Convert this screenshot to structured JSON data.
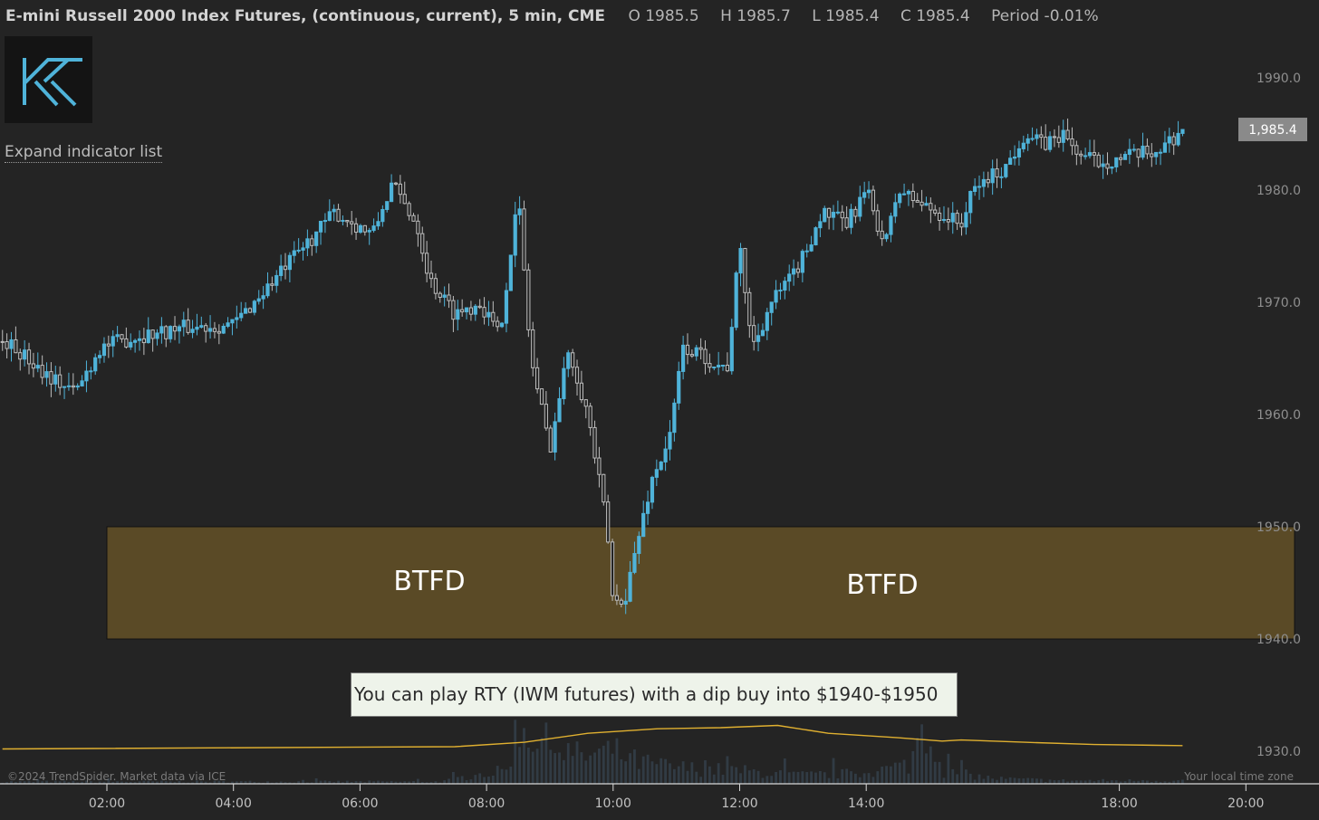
{
  "header": {
    "title": "E-mini Russell 2000 Index Futures, (continuous, current), 5 min, CME",
    "open": "O 1985.5",
    "high": "H 1985.7",
    "low": "L 1985.4",
    "close": "C 1985.4",
    "period": "Period -0.01%"
  },
  "expand_label": "Expand indicator list",
  "note": "You can play RTY (IWM futures) with a dip buy into $1940-$1950",
  "copyright": "©2024 TrendSpider. Market data via ICE",
  "timezone_label": "Your local time zone",
  "colors": {
    "up": "#4fb3d9",
    "down": "#bdbdbd",
    "zone": "#5a4a26",
    "avg": "#e0b030",
    "bg": "#242424"
  },
  "chart_data": {
    "type": "candlestick",
    "interval": "5 min",
    "ylim": [
      1927,
      1993
    ],
    "xlim": [
      0.35,
      21.15
    ],
    "yticks": [
      "1990.0",
      "1980.0",
      "1970.0",
      "1960.0",
      "1950.0",
      "1940.0",
      "1930.0"
    ],
    "xticks": [
      {
        "label": "02:00",
        "hour": 2
      },
      {
        "label": "04:00",
        "hour": 4
      },
      {
        "label": "06:00",
        "hour": 6
      },
      {
        "label": "08:00",
        "hour": 8
      },
      {
        "label": "10:00",
        "hour": 10
      },
      {
        "label": "12:00",
        "hour": 12
      },
      {
        "label": "14:00",
        "hour": 14
      },
      {
        "label": "18:00",
        "hour": 18
      },
      {
        "label": "20:00",
        "hour": 20
      }
    ],
    "last_price": "1,985.4",
    "last_value": 1985.4,
    "zone": {
      "low": 1940,
      "high": 1950,
      "labels": [
        "BTFD",
        "BTFD"
      ]
    },
    "path": [
      [
        0.4,
        1966.5
      ],
      [
        1.2,
        1963
      ],
      [
        1.5,
        1962
      ],
      [
        1.9,
        1966
      ],
      [
        2.5,
        1967
      ],
      [
        3.3,
        1967.8
      ],
      [
        4.0,
        1968
      ],
      [
        4.8,
        1973
      ],
      [
        5.6,
        1978
      ],
      [
        6.2,
        1976
      ],
      [
        6.5,
        1980.5
      ],
      [
        6.9,
        1977
      ],
      [
        7.1,
        1972
      ],
      [
        7.5,
        1969
      ],
      [
        7.9,
        1970
      ],
      [
        8.2,
        1967
      ],
      [
        8.5,
        1979.5
      ],
      [
        8.7,
        1965
      ],
      [
        9.0,
        1957
      ],
      [
        9.3,
        1966
      ],
      [
        9.6,
        1960
      ],
      [
        9.9,
        1950
      ],
      [
        10.0,
        1943
      ],
      [
        10.2,
        1944
      ],
      [
        10.4,
        1949
      ],
      [
        10.6,
        1954
      ],
      [
        10.9,
        1958
      ],
      [
        11.1,
        1966
      ],
      [
        11.5,
        1965
      ],
      [
        11.8,
        1964
      ],
      [
        12.0,
        1975
      ],
      [
        12.2,
        1966
      ],
      [
        12.5,
        1970
      ],
      [
        12.8,
        1972
      ],
      [
        13.0,
        1974
      ],
      [
        13.3,
        1978
      ],
      [
        13.7,
        1977
      ],
      [
        14.0,
        1980
      ],
      [
        14.3,
        1975
      ],
      [
        14.5,
        1980
      ],
      [
        14.8,
        1979
      ],
      [
        15.1,
        1978
      ],
      [
        15.5,
        1977
      ],
      [
        15.7,
        1980
      ],
      [
        15.9,
        1981
      ],
      [
        16.2,
        1982
      ],
      [
        16.5,
        1985
      ],
      [
        16.8,
        1984
      ],
      [
        17.1,
        1985
      ],
      [
        17.4,
        1983
      ],
      [
        17.7,
        1982.5
      ],
      [
        18.2,
        1983
      ],
      [
        18.6,
        1983.5
      ],
      [
        19.0,
        1985.4
      ]
    ],
    "avg_path": [
      [
        0.35,
        1930.2
      ],
      [
        7.5,
        1930.4
      ],
      [
        8.6,
        1930.8
      ],
      [
        9.6,
        1931.6
      ],
      [
        10.7,
        1932.0
      ],
      [
        11.7,
        1932.1
      ],
      [
        12.6,
        1932.3
      ],
      [
        13.4,
        1931.6
      ],
      [
        14.5,
        1931.2
      ],
      [
        15.2,
        1930.9
      ],
      [
        15.5,
        1931.0
      ],
      [
        16.5,
        1930.8
      ],
      [
        17.6,
        1930.6
      ],
      [
        19.0,
        1930.5
      ]
    ],
    "volume_profile": [
      [
        0.35,
        0.2
      ],
      [
        7.3,
        0.2
      ],
      [
        7.8,
        0.8
      ],
      [
        8.3,
        1.2
      ],
      [
        8.5,
        5.5
      ],
      [
        9.0,
        3.5
      ],
      [
        9.5,
        2.5
      ],
      [
        10.0,
        3.0
      ],
      [
        10.4,
        2.0
      ],
      [
        11.0,
        1.5
      ],
      [
        12.0,
        1.2
      ],
      [
        13.0,
        0.8
      ],
      [
        14.0,
        1.0
      ],
      [
        14.7,
        1.8
      ],
      [
        14.9,
        6.0
      ],
      [
        15.2,
        1.2
      ],
      [
        16.0,
        0.5
      ],
      [
        17.0,
        0.3
      ],
      [
        19.0,
        0.3
      ]
    ]
  }
}
